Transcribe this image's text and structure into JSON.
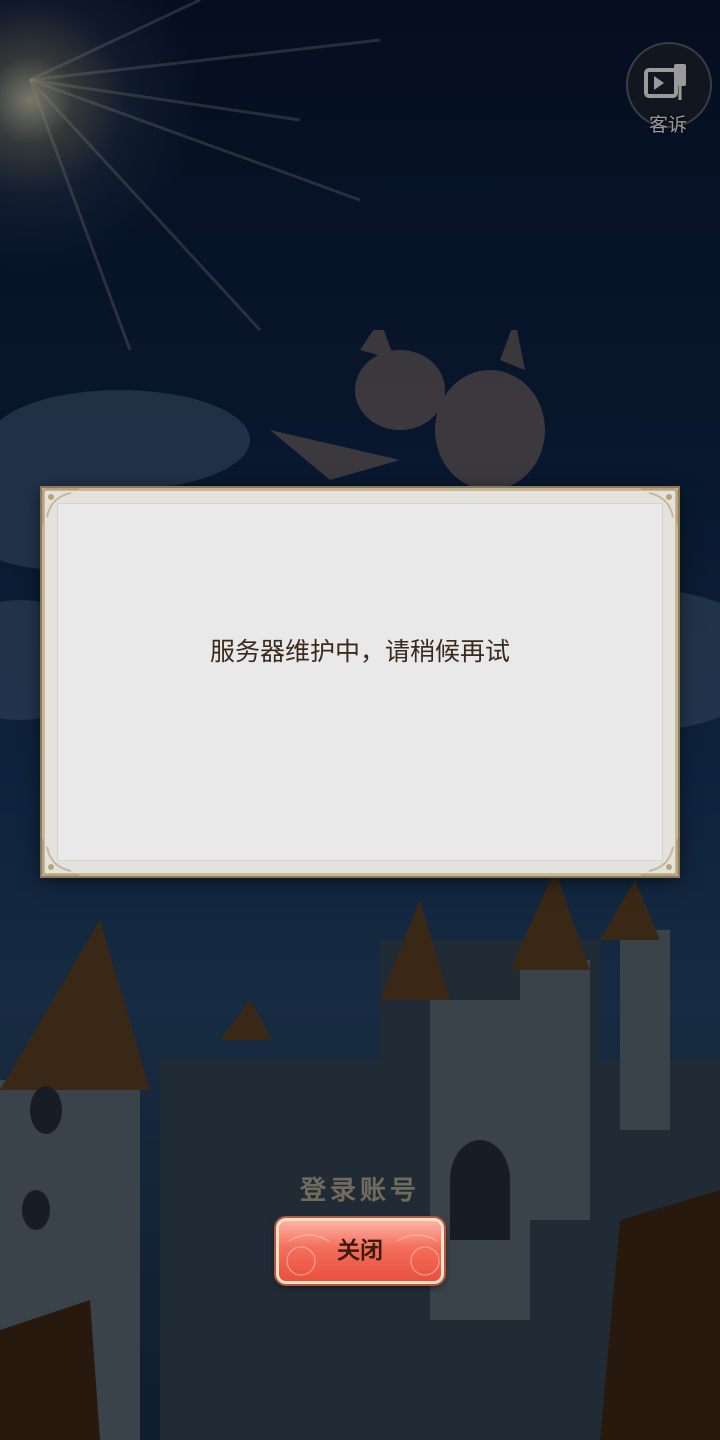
{
  "topbar": {
    "complain_label": "客诉",
    "complain_icon": "megaphone-icon"
  },
  "login": {
    "account_label": "登录账号"
  },
  "dialog": {
    "message": "服务器维护中，请稍候再试",
    "close_label": "关闭"
  },
  "colors": {
    "dialog_bg": "#e9e9e9",
    "dialog_border": "#c9b896",
    "message_text": "#3a2a1e",
    "button_red": "#f36e5a"
  }
}
